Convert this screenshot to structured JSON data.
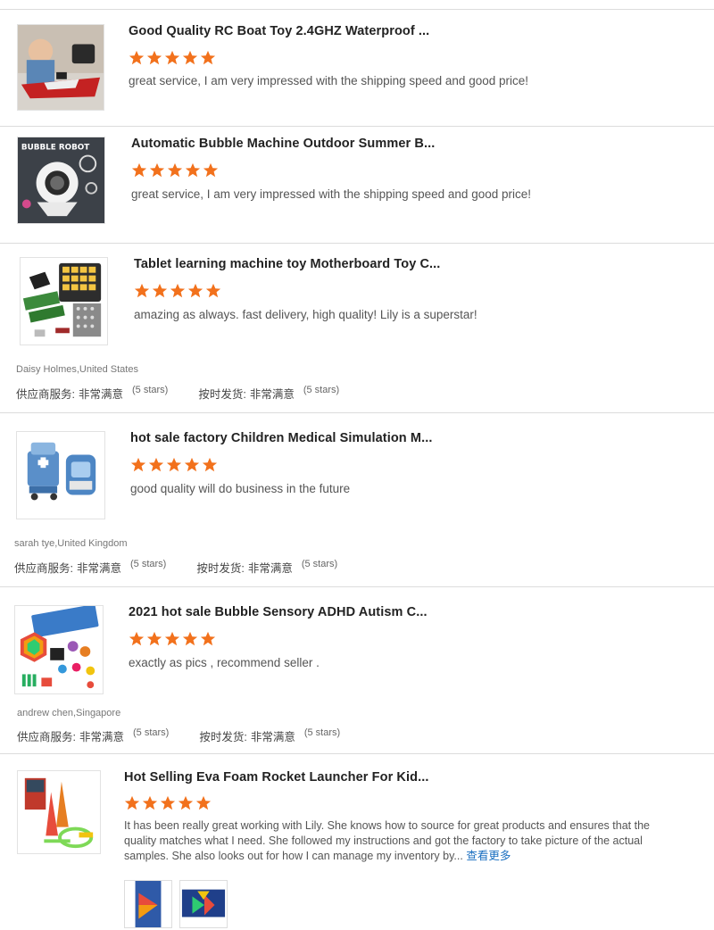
{
  "reviews": [
    {
      "title": "Good Quality RC Boat Toy 2.4GHZ Waterproof ...",
      "stars": 5,
      "comment": "great service, I am very impressed with the shipping speed and good price!",
      "image": "rc-boat-product-image"
    },
    {
      "title": "Automatic Bubble Machine Outdoor Summer B...",
      "stars": 5,
      "comment": "great service, I am very impressed with the shipping speed and good price!",
      "image": "bubble-robot-product-image",
      "image_text": "BUBBLE ROBOT"
    },
    {
      "title": "Tablet learning machine toy Motherboard Toy C...",
      "stars": 5,
      "comment": "amazing as always. fast delivery, high quality! Lily is a superstar!",
      "image": "tablet-motherboard-product-image",
      "reviewer": "Daisy Holmes,United States",
      "supplier_service_label": "供应商服务:",
      "supplier_service_value": "非常满意",
      "supplier_service_note": "(5 stars)",
      "on_time_label": "按时发货:",
      "on_time_value": "非常满意",
      "on_time_note": "(5 stars)"
    },
    {
      "title": "hot sale factory Children Medical Simulation M...",
      "stars": 5,
      "comment": "good quality will do business in the future",
      "image": "medical-kit-product-image",
      "reviewer": "sarah tye,United Kingdom",
      "supplier_service_label": "供应商服务:",
      "supplier_service_value": "非常满意",
      "supplier_service_note": "(5 stars)",
      "on_time_label": "按时发货:",
      "on_time_value": "非常满意",
      "on_time_note": "(5 stars)"
    },
    {
      "title": "2021 hot sale Bubble Sensory ADHD Autism C...",
      "stars": 5,
      "comment": "exactly as pics , recommend seller .",
      "image": "sensory-toys-product-image",
      "reviewer": "andrew chen,Singapore",
      "supplier_service_label": "供应商服务:",
      "supplier_service_value": "非常满意",
      "supplier_service_note": "(5 stars)",
      "on_time_label": "按时发货:",
      "on_time_value": "非常满意",
      "on_time_note": "(5 stars)"
    },
    {
      "title": "Hot Selling Eva Foam Rocket Launcher For Kid...",
      "stars": 5,
      "comment": "It has been really great working with Lily. She knows how to source for great products and ensures that the quality matches what I need. She followed my instructions and got the factory to take picture of the actual samples. She also looks out for how I can manage my inventory by...",
      "more_label": "查看更多",
      "image": "rocket-launcher-product-image",
      "photos": [
        "review-photo-1",
        "review-photo-2"
      ]
    }
  ],
  "colors": {
    "star": "#f2711c",
    "link": "#1a6fc0",
    "divider": "#dcdcdc"
  }
}
